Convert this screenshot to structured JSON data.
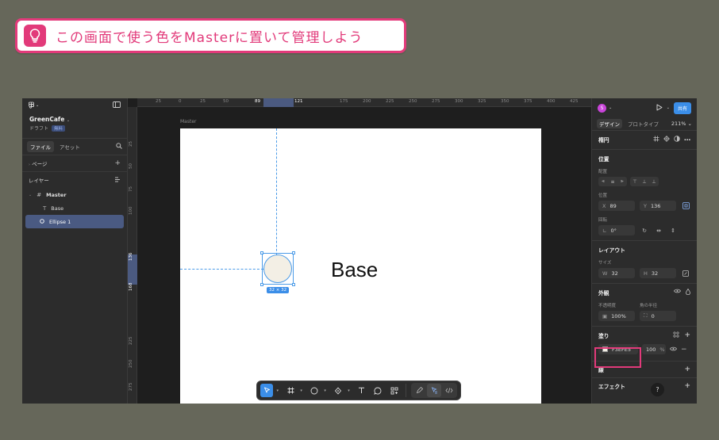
{
  "banner": {
    "text": "この画面で使う色をMasterに置いて管理しよう"
  },
  "left": {
    "file_name": "GreenCafe",
    "file_status": "ドラフト",
    "plan_badge": "無料",
    "tabs": [
      {
        "label": "ファイル"
      },
      {
        "label": "アセット"
      }
    ],
    "pages_label": "ページ",
    "layers_label": "レイヤー",
    "layers": [
      {
        "name": "Master"
      },
      {
        "name": "Base"
      },
      {
        "name": "Ellipse 1"
      }
    ]
  },
  "canvas": {
    "ruler_h": [
      "25",
      "0",
      "25",
      "50",
      "89",
      "121",
      "175",
      "200",
      "225",
      "250",
      "275",
      "300",
      "325",
      "350",
      "375",
      "400",
      "425"
    ],
    "ruler_v": [
      "25",
      "50",
      "75",
      "100",
      "136",
      "168",
      "225",
      "250",
      "275"
    ],
    "frame_label": "Master",
    "base_text": "Base",
    "size_tag": "32 × 32"
  },
  "right": {
    "avatar": "S",
    "share_label": "共有",
    "tabs": [
      {
        "label": "デザイン"
      },
      {
        "label": "プロトタイプ"
      }
    ],
    "zoom": "211%",
    "layer_type": "楕円",
    "position": {
      "title": "位置",
      "align_label": "配置",
      "pos_label": "位置",
      "x_label": "X",
      "x": "89",
      "y_label": "Y",
      "y": "136",
      "rotation_label": "回転",
      "rotation": "0°"
    },
    "layout": {
      "title": "レイアウト",
      "size_label": "サイズ",
      "w_label": "W",
      "w": "32",
      "h_label": "H",
      "h": "32"
    },
    "appearance": {
      "title": "外観",
      "opacity_label": "不透明度",
      "opacity": "100%",
      "radius_label": "角の半径",
      "radius": "0"
    },
    "fill": {
      "title": "塗り",
      "hex": "F3EFE5",
      "alpha": "100",
      "alpha_unit": "%"
    },
    "stroke_title": "線",
    "effects_title": "エフェクト"
  },
  "help": "?",
  "colors": {
    "accent": "#e23a7a",
    "selection": "#3b8ee8",
    "fill": "#f3efe5"
  }
}
